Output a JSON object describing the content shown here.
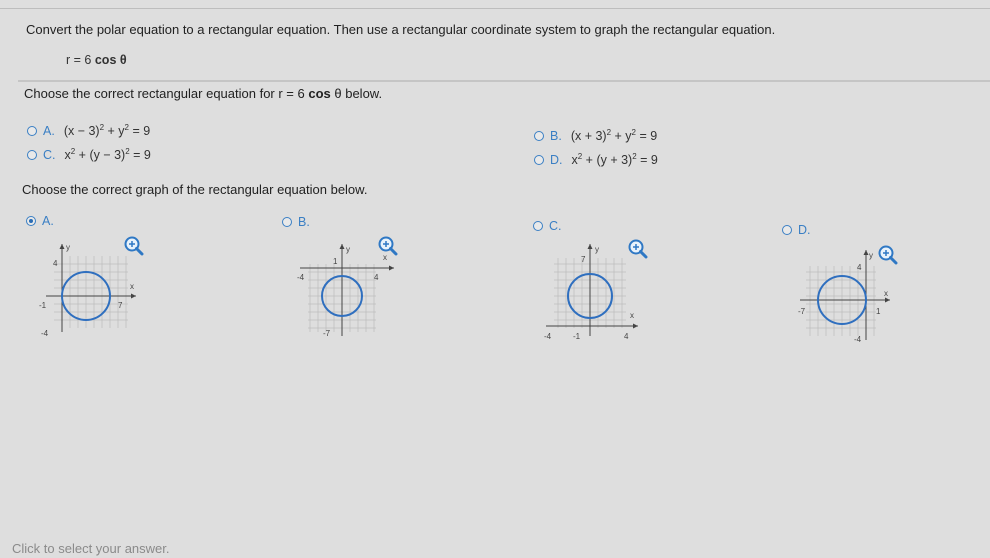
{
  "question": {
    "text": "Convert the polar equation to a rectangular equation. Then use a rectangular coordinate system to graph the rectangular equation.",
    "given_lhs": "r = 6",
    "given_func": "cos",
    "given_var": "θ"
  },
  "prompt1": {
    "before": "Choose the correct rectangular equation for r = 6 ",
    "bold": "cos",
    "after": " θ below."
  },
  "equation_choices": [
    {
      "letter": "A.",
      "parts": [
        "(x − 3)",
        "2",
        " + y",
        "2",
        " = 9"
      ]
    },
    {
      "letter": "B.",
      "parts": [
        "(x + 3)",
        "2",
        " + y",
        "2",
        " = 9"
      ]
    },
    {
      "letter": "C.",
      "parts": [
        "x",
        "2",
        " + (y − 3)",
        "2",
        " = 9"
      ]
    },
    {
      "letter": "D.",
      "parts": [
        "x",
        "2",
        " + (y + 3)",
        "2",
        " = 9"
      ]
    }
  ],
  "prompt2": "Choose the correct graph of the rectangular equation below.",
  "graph_choices": [
    {
      "letter": "A.",
      "selected": true,
      "labels": {
        "y": "y",
        "x": "x",
        "top": "4",
        "left": "-1",
        "right": "7",
        "bottom": "-4"
      }
    },
    {
      "letter": "B.",
      "selected": false,
      "labels": {
        "y": "y",
        "x": "x",
        "top": "1",
        "left": "-4",
        "right": "4",
        "bottom": "-7"
      }
    },
    {
      "letter": "C.",
      "selected": false,
      "labels": {
        "y": "y",
        "x": "x",
        "top": "7",
        "left": "-4",
        "right": "4",
        "bottom": "-1"
      }
    },
    {
      "letter": "D.",
      "selected": false,
      "labels": {
        "y": "y",
        "x": "x",
        "top": "4",
        "left": "-7",
        "right": "1",
        "bottom": "-4"
      }
    }
  ],
  "footer": "Click to select your answer.",
  "colors": {
    "accent": "#3a7fc4",
    "circle": "#2f6fbf",
    "grid": "#b9b9b9"
  },
  "icons": {
    "zoom": "zoom-in-icon"
  }
}
